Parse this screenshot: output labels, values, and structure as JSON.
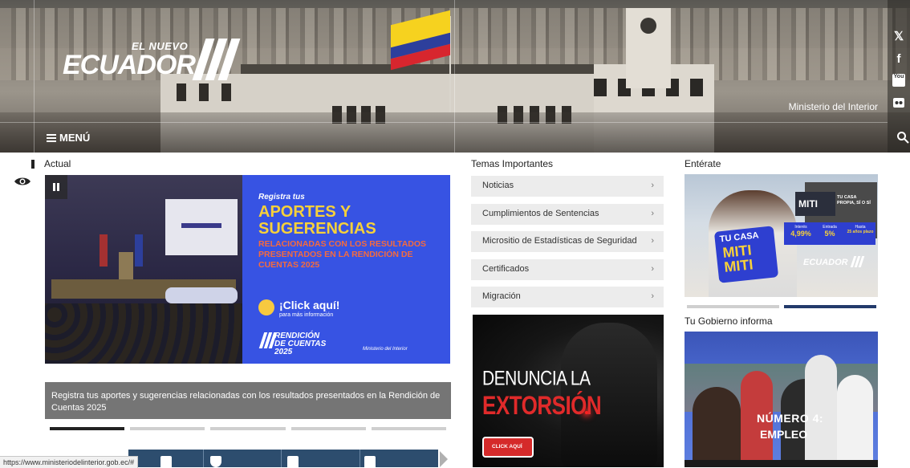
{
  "hero": {
    "logo_small": "EL NUEVO",
    "logo_big": "ECUADOR",
    "ministry": "Ministerio del Interior",
    "menu_label": "MENÚ"
  },
  "social": {
    "icons": [
      "x-icon",
      "facebook-icon",
      "youtube-icon",
      "flickr-icon"
    ],
    "youtube_text": "You"
  },
  "actual": {
    "title": "Actual",
    "slide": {
      "registra": "Registra tus",
      "headline": "APORTES Y SUGERENCIAS",
      "subhead": "RELACIONADAS CON LOS RESULTADOS PRESENTADOS EN LA RENDICIÓN DE CUENTAS 2025",
      "click": "¡Click aquí!",
      "click_sub": "para más información",
      "rendicion": "RENDICIÓN DE CUENTAS 2025",
      "ministry": "Ministerio del Interior"
    },
    "caption": "Registra tus aportes y sugerencias relacionadas con los resultados presentados en la Rendición de Cuentas 2025",
    "dots": 5,
    "active_dot": 0
  },
  "temas": {
    "title": "Temas Importantes",
    "items": [
      {
        "label": "Noticias"
      },
      {
        "label": "Cumplimientos de Sentencias"
      },
      {
        "label": "Micrositio de Estadísticas de Seguridad"
      },
      {
        "label": "Certificados"
      },
      {
        "label": "Migración"
      }
    ],
    "chevron": "›"
  },
  "extorsion": {
    "line1": "DENUNCIA LA",
    "line2": "EXTORSIÓN",
    "button": "CLICK AQUÍ"
  },
  "enterate": {
    "title": "Entérate",
    "tu_casa": "TU CASA",
    "miti": "MITI MITI",
    "credito": "MITI",
    "casa_propia": "TU CASA PROPIA, SÍ O SÍ",
    "rates": [
      {
        "label": "Interés",
        "value": "4,99%"
      },
      {
        "label": "Entrada",
        "value": "5%"
      },
      {
        "label": "Hasta",
        "value": "25 años plazo"
      }
    ],
    "ecuador": "ECUADOR",
    "active_dot": 1
  },
  "gobierno": {
    "title": "Tu Gobierno informa",
    "numero": "NÚMERO 4:",
    "empleo": "EMPLEO"
  },
  "status_url": "https://www.ministeriodelinterior.gob.ec/#"
}
